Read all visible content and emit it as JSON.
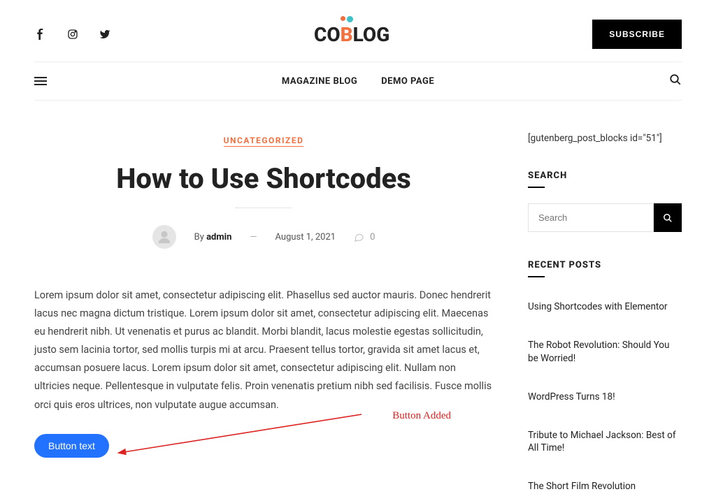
{
  "header": {
    "logo_parts": {
      "a": "CO",
      "b": "B",
      "c": "LOG"
    },
    "subscribe": "SUBSCRIBE"
  },
  "nav": {
    "items": [
      "MAGAZINE BLOG",
      "DEMO PAGE"
    ]
  },
  "article": {
    "category": "UNCATEGORIZED",
    "title": "How to Use Shortcodes",
    "by_prefix": "By ",
    "author": "admin",
    "dash": "—",
    "date": "August 1, 2021",
    "comments": "0",
    "body": "Lorem ipsum dolor sit amet, consectetur adipiscing elit. Phasellus sed auctor mauris. Donec hendrerit lacus nec magna dictum tristique. Lorem ipsum dolor sit amet, consectetur adipiscing elit. Maecenas eu hendrerit nibh. Ut venenatis et purus ac blandit. Morbi blandit, lacus molestie egestas sollicitudin, justo sem lacinia tortor, sed mollis turpis mi at arcu. Praesent tellus tortor, gravida sit amet lacus et, accumsan posuere lacus. Lorem ipsum dolor sit amet, consectetur adipiscing elit. Nullam non ultricies neque. Pellentesque in vulputate felis. Proin venenatis pretium nibh sed facilisis. Fusce mollis orci quis eros ultrices, non vulputate augue accumsan.",
    "button_label": "Button text",
    "annotation": "Button Added"
  },
  "sidebar": {
    "shortcode_text": "[gutenberg_post_blocks id=\"51\"]",
    "search_title": "SEARCH",
    "search_placeholder": "Search",
    "recent_title": "RECENT POSTS",
    "recent": [
      "Using Shortcodes with Elementor",
      "The Robot Revolution: Should You be Worried!",
      "WordPress Turns 18!",
      "Tribute to Michael Jackson: Best of All Time!",
      "The Short Film Revolution"
    ]
  }
}
